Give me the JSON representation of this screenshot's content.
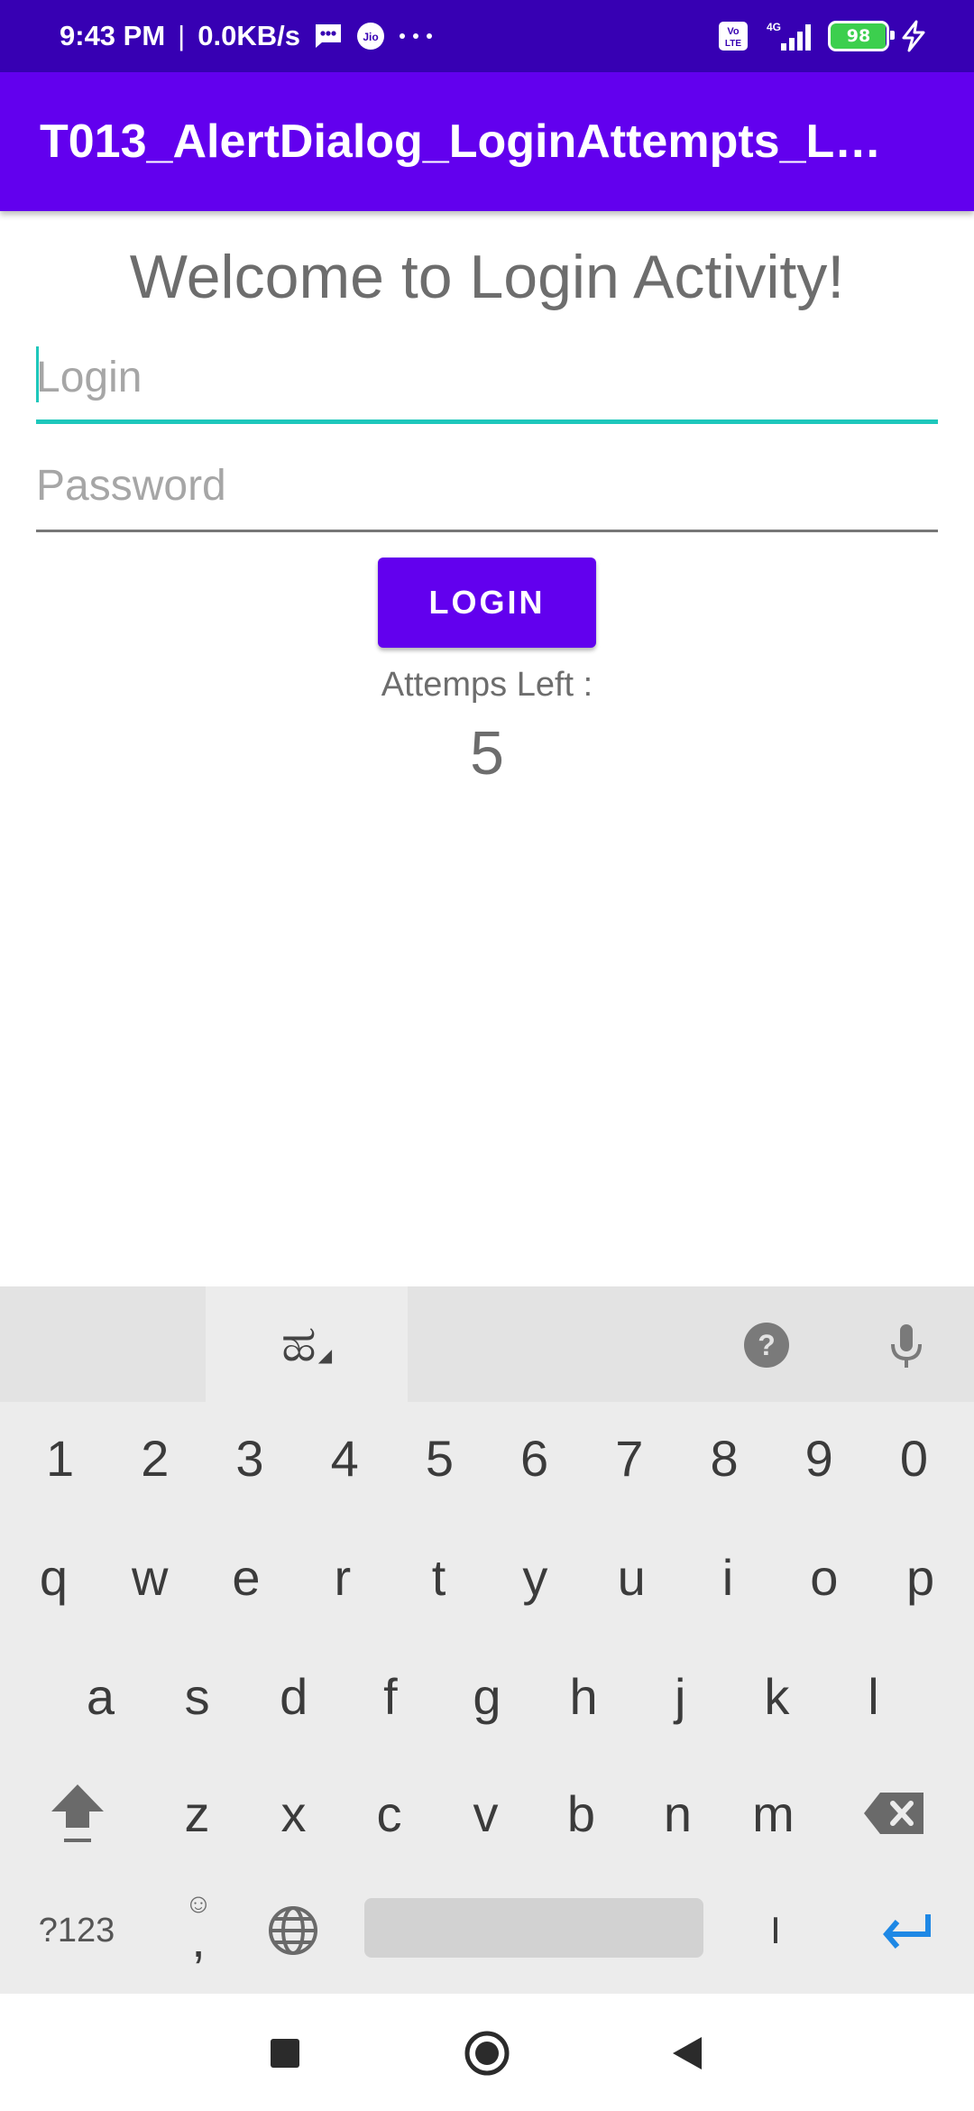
{
  "status_bar": {
    "time": "9:43 PM",
    "separator": "|",
    "speed": "0.0KB/s",
    "battery": "98",
    "network": "4G"
  },
  "app_bar": {
    "title": "T013_AlertDialog_LoginAttempts_L…"
  },
  "main": {
    "welcome": "Welcome to Login Activity!",
    "login_placeholder": "Login",
    "password_placeholder": "Password",
    "login_button": "LOGIN",
    "attempts_label": "Attemps Left :",
    "attempts_value": "5"
  },
  "keyboard": {
    "language_key": "ಹ",
    "number_row": [
      "1",
      "2",
      "3",
      "4",
      "5",
      "6",
      "7",
      "8",
      "9",
      "0"
    ],
    "row1": [
      "q",
      "w",
      "e",
      "r",
      "t",
      "y",
      "u",
      "i",
      "o",
      "p"
    ],
    "row2": [
      "a",
      "s",
      "d",
      "f",
      "g",
      "h",
      "j",
      "k",
      "l"
    ],
    "row3": [
      "z",
      "x",
      "c",
      "v",
      "b",
      "n",
      "m"
    ],
    "symbols_key": "?123",
    "comma_key": ",",
    "period_key": "I"
  }
}
